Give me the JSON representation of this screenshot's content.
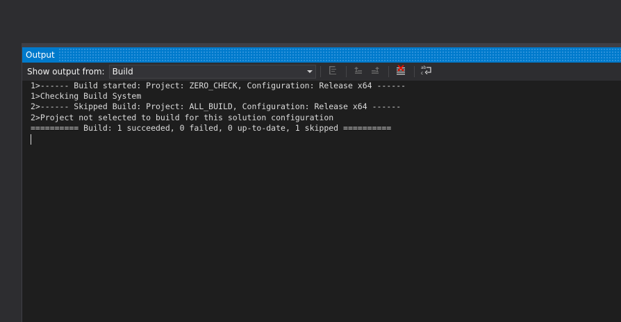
{
  "panel": {
    "title": "Output"
  },
  "toolbar": {
    "show_output_label": "Show output from:",
    "source_selected": "Build",
    "buttons": [
      {
        "name": "find-message-in-code-icon"
      },
      {
        "name": "go-to-previous-message-icon"
      },
      {
        "name": "go-to-next-message-icon"
      },
      {
        "name": "clear-all-icon"
      },
      {
        "name": "toggle-word-wrap-icon"
      }
    ]
  },
  "output": {
    "lines": [
      "1>------ Build started: Project: ZERO_CHECK, Configuration: Release x64 ------",
      "1>Checking Build System",
      "2>------ Skipped Build: Project: ALL_BUILD, Configuration: Release x64 ------",
      "2>Project not selected to build for this solution configuration",
      "========== Build: 1 succeeded, 0 failed, 0 up-to-date, 1 skipped =========="
    ]
  },
  "colors": {
    "accent": "#007acc",
    "background": "#1e1e1e",
    "chrome": "#2d2d30",
    "text": "#dcdcdc",
    "clear_icon_red": "#e51400"
  }
}
